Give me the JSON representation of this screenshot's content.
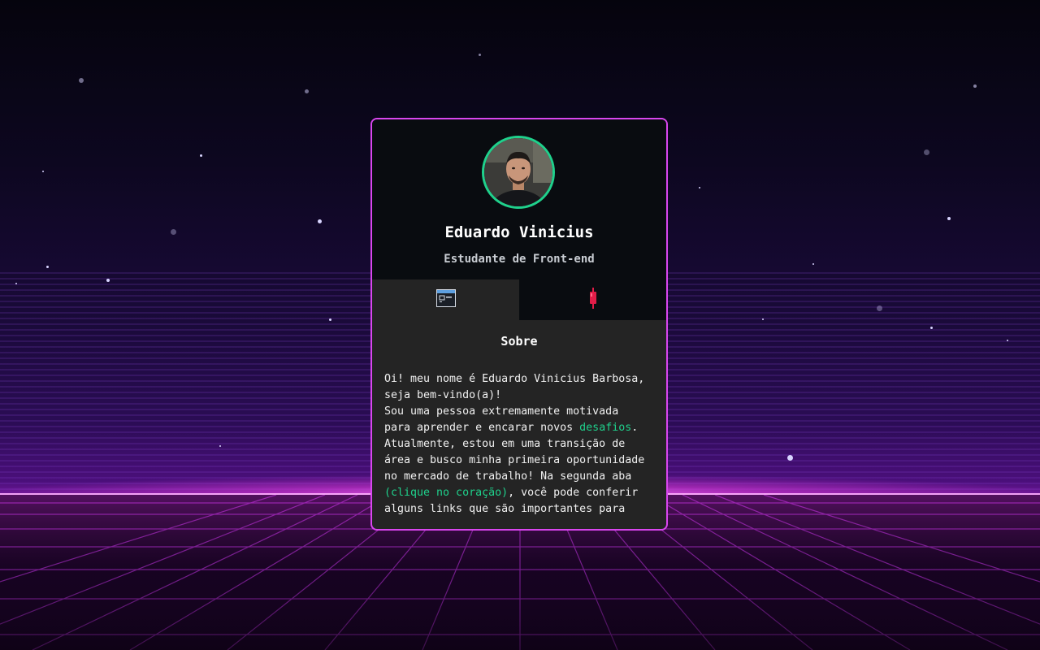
{
  "profile": {
    "name": "Eduardo Vinicius",
    "role": "Estudante de Front-end"
  },
  "tabs": [
    {
      "icon": "browser-window-icon",
      "active": true
    },
    {
      "icon": "heart-icon",
      "active": false
    }
  ],
  "section": {
    "title": "Sobre"
  },
  "about": {
    "line1": "Oi! meu nome é Eduardo Vinicius Barbosa,",
    "line2": "seja bem-vindo(a)!",
    "line3": "Sou uma pessoa extremamente motivada",
    "line4_a": "para aprender e encarar novos ",
    "line4_b": "desafios",
    "line4_c": ".",
    "line5": "Atualmente, estou em uma transição de",
    "line6": "área e busco minha primeira oportunidade",
    "line7": "no mercado de trabalho! Na segunda aba",
    "line8_a": "(clique no coração)",
    "line8_b": ", você pode conferir",
    "line9": "alguns links que são importantes para"
  },
  "colors": {
    "accent": "#1fd18c",
    "card_border": "#d946ef",
    "card_bg": "#242424",
    "header_bg": "#090c10",
    "heart": "#e11d48"
  }
}
